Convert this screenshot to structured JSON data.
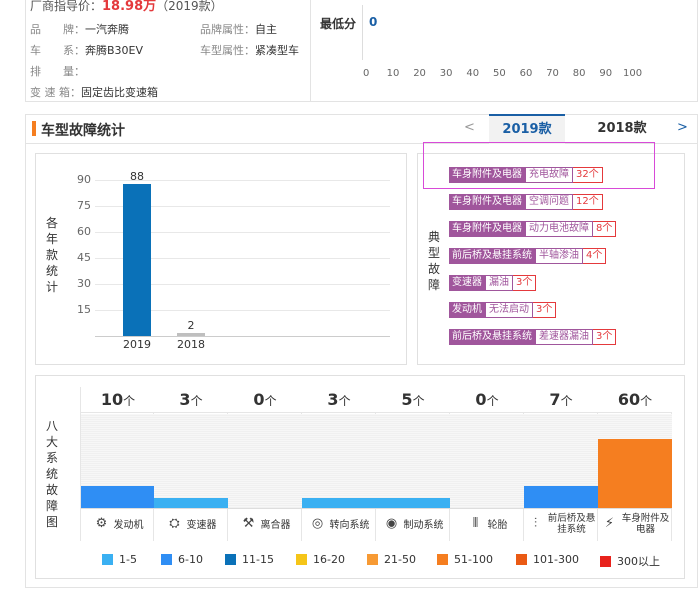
{
  "info": {
    "price_label": "厂商指导价：",
    "price_value": "18.98万",
    "price_year": "（2019款）",
    "rows": [
      {
        "k1": "品　　牌：",
        "v1": "一汽奔腾",
        "k2": "品牌属性：",
        "v2": "自主"
      },
      {
        "k1": "车　　系：",
        "v1": "奔腾B30EV",
        "k2": "车型属性：",
        "v2": "紧凑型车"
      },
      {
        "k1": "排　　量：",
        "v1": "",
        "k2": "",
        "v2": ""
      },
      {
        "k1": "变 速 箱：",
        "v1": "固定齿比变速箱",
        "k2": "",
        "v2": ""
      }
    ],
    "min_score_label": "最低分",
    "min_score_value": "0",
    "scale_ticks": [
      "0",
      "10",
      "20",
      "30",
      "40",
      "50",
      "60",
      "70",
      "80",
      "90",
      "100"
    ]
  },
  "section": {
    "title": "车型故障统计",
    "prev_arrow": "<",
    "next_arrow": ">",
    "tabs": [
      {
        "label": "2019款",
        "active": true
      },
      {
        "label": "2018款",
        "active": false
      }
    ]
  },
  "chart_data": {
    "type": "bar",
    "ylabel": "各年款统计",
    "categories": [
      "2019",
      "2018"
    ],
    "values": [
      88,
      2
    ],
    "yticks": [
      90,
      75,
      60,
      45,
      30,
      15
    ],
    "ylim": [
      0,
      100
    ],
    "colors": [
      "#0a71b8",
      "#bfbfbf"
    ]
  },
  "typical": {
    "label": "典型故障",
    "faults": [
      {
        "sys": "车身附件及电器",
        "issue": "充电故障",
        "count": "32个"
      },
      {
        "sys": "车身附件及电器",
        "issue": "空调问题",
        "count": "12个"
      },
      {
        "sys": "车身附件及电器",
        "issue": "动力电池故障",
        "count": "8个"
      },
      {
        "sys": "前后桥及悬挂系统",
        "issue": "半轴渗油",
        "count": "4个"
      },
      {
        "sys": "变速器",
        "issue": "漏油",
        "count": "3个"
      },
      {
        "sys": "发动机",
        "issue": "无法启动",
        "count": "3个"
      },
      {
        "sys": "前后桥及悬挂系统",
        "issue": "差速器漏油",
        "count": "3个"
      }
    ]
  },
  "eight": {
    "label": "八大系统故障图",
    "unit": "个",
    "systems": [
      {
        "count": "10",
        "name": "发动机",
        "icon": "engine-icon",
        "glyph": "⚙",
        "level": 0.23,
        "color": "#2f8ef4"
      },
      {
        "count": "3",
        "name": "变速器",
        "icon": "gear-shift-icon",
        "glyph": "⛭",
        "level": 0.11,
        "color": "#3ab0f2"
      },
      {
        "count": "0",
        "name": "离合器",
        "icon": "clutch-icon",
        "glyph": "⚒",
        "level": 0,
        "color": "#3ab0f2"
      },
      {
        "count": "3",
        "name": "转向系统",
        "icon": "steering-wheel-icon",
        "glyph": "◎",
        "level": 0.11,
        "color": "#3ab0f2"
      },
      {
        "count": "5",
        "name": "制动系统",
        "icon": "brake-icon",
        "glyph": "◉",
        "level": 0.11,
        "color": "#3ab0f2"
      },
      {
        "count": "0",
        "name": "轮胎",
        "icon": "tire-icon",
        "glyph": "⦀",
        "level": 0,
        "color": "#3ab0f2"
      },
      {
        "count": "7",
        "name": "前后桥及悬挂系统",
        "icon": "suspension-icon",
        "glyph": "⫶",
        "level": 0.23,
        "color": "#2f8ef4"
      },
      {
        "count": "60",
        "name": "车身附件及电器",
        "icon": "car-electric-icon",
        "glyph": "⚡",
        "level": 0.73,
        "color": "#f57e20"
      }
    ],
    "legend": [
      {
        "label": "1-5",
        "color": "#3ab0f2"
      },
      {
        "label": "6-10",
        "color": "#2f8ef4"
      },
      {
        "label": "11-15",
        "color": "#0a71b8"
      },
      {
        "label": "16-20",
        "color": "#f5c518"
      },
      {
        "label": "21-50",
        "color": "#f79a34"
      },
      {
        "label": "51-100",
        "color": "#f57e20"
      },
      {
        "label": "101-300",
        "color": "#ea5a14"
      },
      {
        "label": "300以上",
        "color": "#e8221c"
      }
    ]
  }
}
